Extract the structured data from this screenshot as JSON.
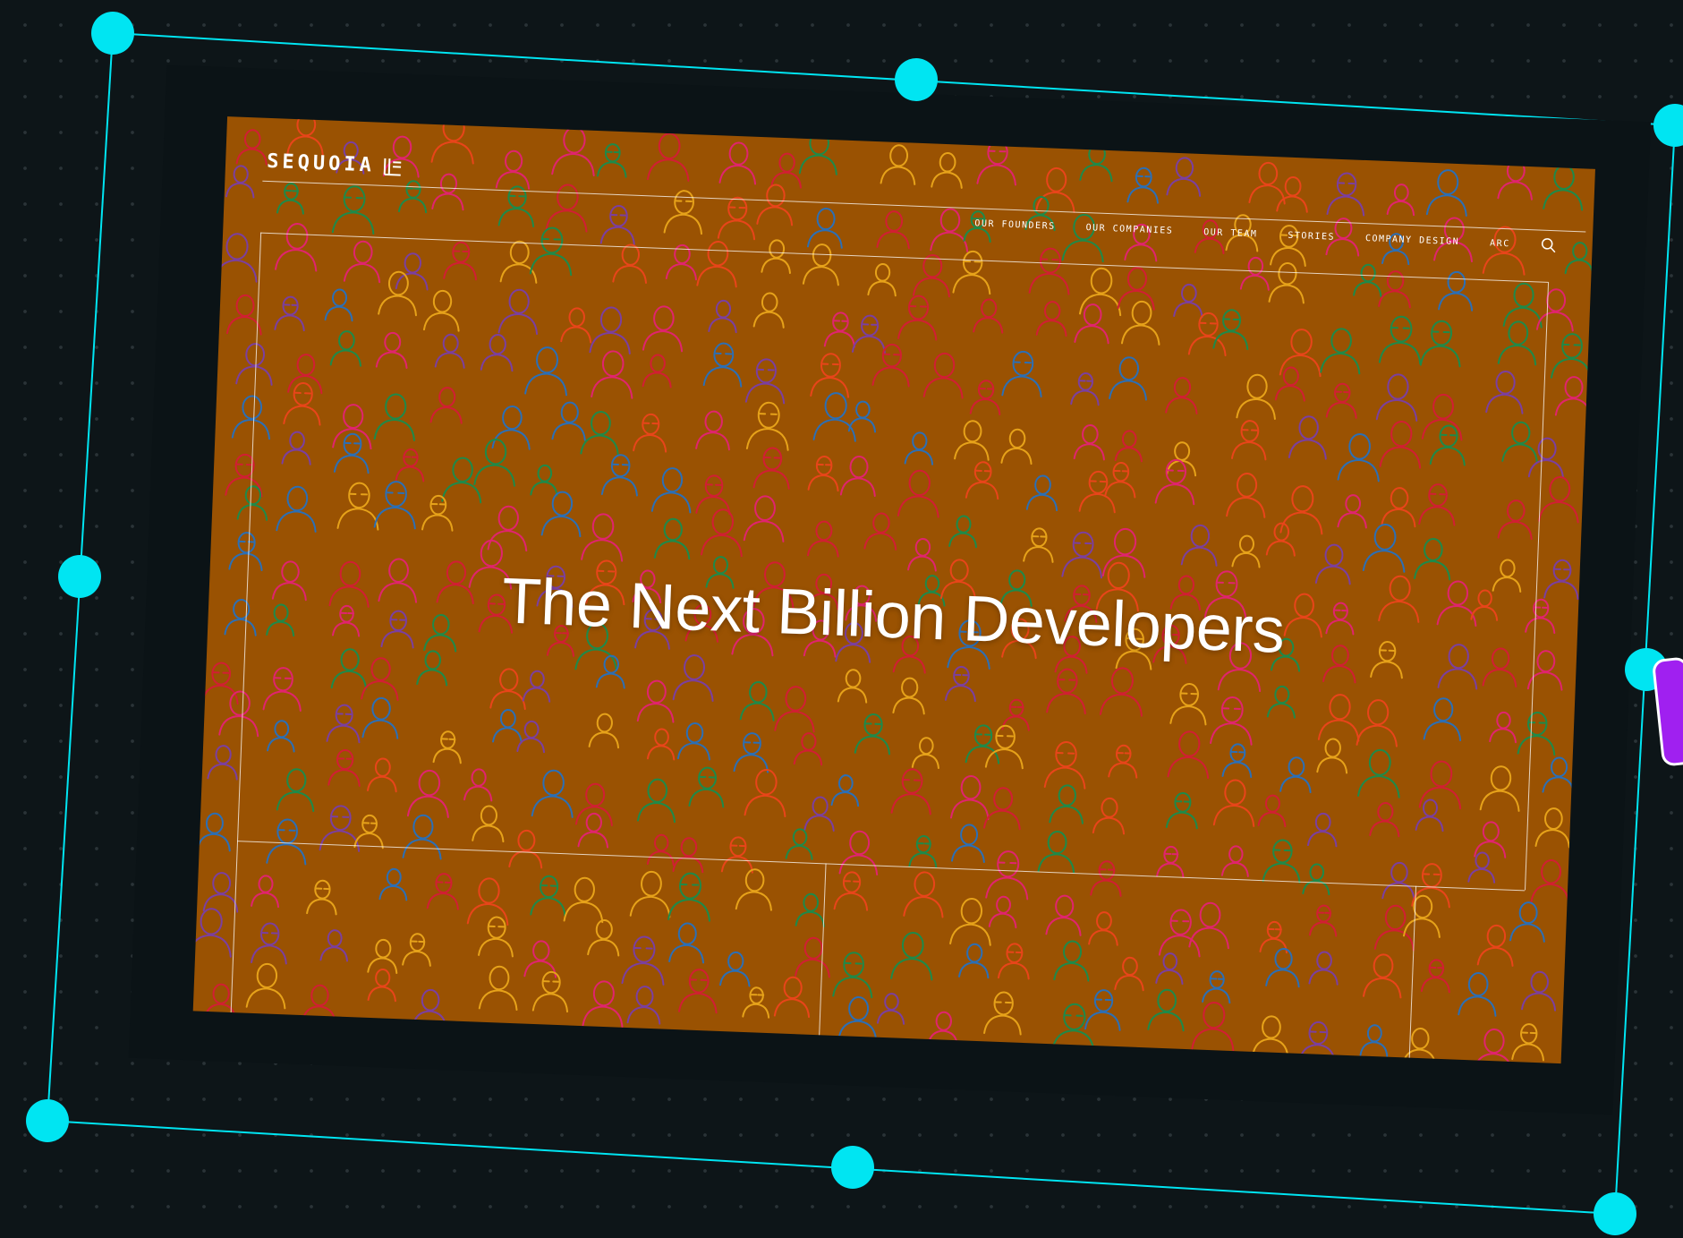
{
  "canvas": {
    "background_color": "#0d1518",
    "dot_color": "#2a3337",
    "selection_color": "#00e5f2",
    "side_tab_color": "#a020f0"
  },
  "page": {
    "background_color": "#9a5202",
    "logo": {
      "text": "SEQUOIA",
      "mark_icon": "sequoia-logo-mark"
    },
    "nav": {
      "items": [
        {
          "label": "OUR FOUNDERS"
        },
        {
          "label": "OUR COMPANIES"
        },
        {
          "label": "OUR TEAM"
        },
        {
          "label": "STORIES"
        },
        {
          "label": "COMPANY DESIGN"
        },
        {
          "label": "ARC"
        }
      ],
      "search_icon": "search-icon"
    },
    "hero": {
      "title": "The Next Billion Developers"
    },
    "doodle_colors": [
      "#d11f33",
      "#e0246e",
      "#1e8a4a",
      "#e6a21a",
      "#7b3fa0",
      "#2b6fb6",
      "#e8451a"
    ]
  }
}
